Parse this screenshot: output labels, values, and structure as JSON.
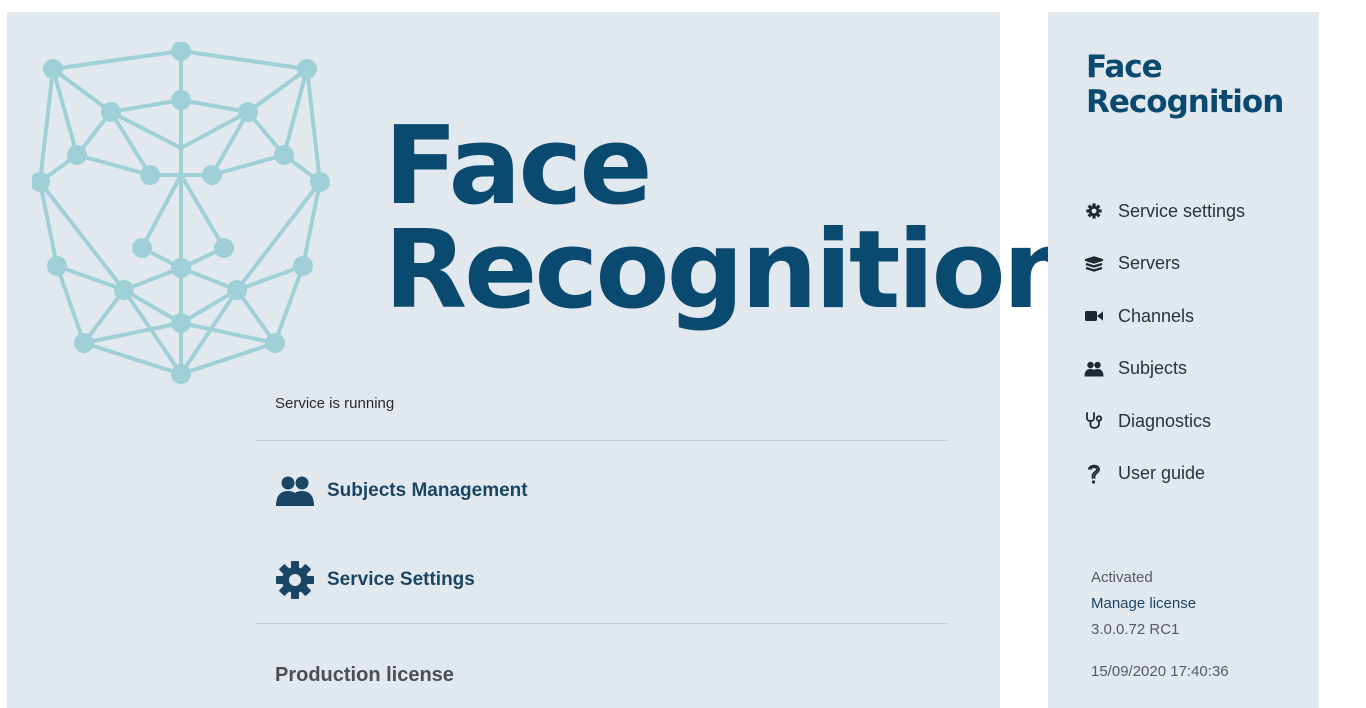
{
  "app": {
    "title_line1": "Face",
    "title_line2": "Recognition"
  },
  "main": {
    "status": "Service is running",
    "actions": [
      {
        "label": "Subjects Management",
        "icon": "users-icon"
      },
      {
        "label": "Service Settings",
        "icon": "gear-icon"
      }
    ],
    "license_heading": "Production license"
  },
  "sidebar": {
    "title_line1": "Face",
    "title_line2": "Recognition",
    "items": [
      {
        "label": "Service settings",
        "icon": "gear-icon"
      },
      {
        "label": "Servers",
        "icon": "servers-icon"
      },
      {
        "label": "Channels",
        "icon": "camera-icon"
      },
      {
        "label": "Subjects",
        "icon": "users-icon"
      },
      {
        "label": "Diagnostics",
        "icon": "stethoscope-icon"
      },
      {
        "label": "User guide",
        "icon": "question-icon"
      }
    ],
    "footer": {
      "activation": "Activated",
      "manage_license": "Manage license",
      "version": "3.0.0.72 RC1",
      "timestamp": "15/09/2020 17:40:36"
    }
  },
  "colors": {
    "brand": "#0b4a70",
    "panel_bg": "#e2e9ee",
    "face_mesh": "#9fd0d8",
    "link": "#1b4565"
  }
}
